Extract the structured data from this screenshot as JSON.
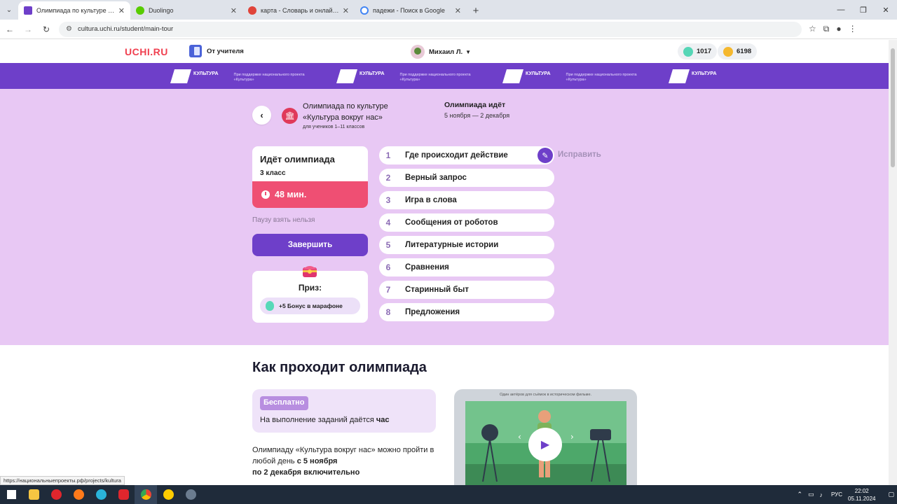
{
  "browser": {
    "tabs": [
      {
        "title": "Олимпиада по культуре «Культ",
        "color": "#6e3fc9",
        "active": true
      },
      {
        "title": "Duolingo",
        "color": "#58cc02",
        "active": false
      },
      {
        "title": "карта - Словарь и онлайн-пер",
        "color": "#e0443a",
        "active": false
      },
      {
        "title": "падежи - Поиск в Google",
        "color": "#4285f4",
        "active": false
      }
    ],
    "url": "cultura.uchi.ru/student/main-tour",
    "status_url": "https://национальныепроекты.рф/projects/kultura"
  },
  "header": {
    "logo": "UCHI.RU",
    "teacher_label": "От учителя",
    "user_name": "Михаил Л.",
    "gems": "1017",
    "coins": "6198"
  },
  "banner": {
    "brand": "КУЛЬТУРА",
    "support_text": "При поддержке национального проекта «Культура»"
  },
  "olympiad": {
    "title_line1": "Олимпиада по культуре",
    "title_line2": "«Культура вокруг нас»",
    "subtitle": "для учеников 1–11 классов",
    "status": "Олимпиада идёт",
    "dates": "5 ноября — 2 декабря",
    "card_heading": "Идёт олимпиада",
    "grade": "3 класс",
    "timer": "48 мин.",
    "no_pause": "Паузу взять нельзя",
    "finish_label": "Завершить",
    "prize_label": "Приз:",
    "prize_bonus": "+5 Бонус в марафоне",
    "fix_label": "Исправить"
  },
  "tasks": [
    {
      "num": "1",
      "name": "Где происходит действие"
    },
    {
      "num": "2",
      "name": "Верный запрос"
    },
    {
      "num": "3",
      "name": "Игра в слова"
    },
    {
      "num": "4",
      "name": "Сообщения от роботов"
    },
    {
      "num": "5",
      "name": "Литературные истории"
    },
    {
      "num": "6",
      "name": "Сравнения"
    },
    {
      "num": "7",
      "name": "Старинный быт"
    },
    {
      "num": "8",
      "name": "Предложения"
    }
  ],
  "howto": {
    "heading": "Как проходит олимпиада",
    "free_tag": "Бесплатно",
    "time_text": "На выполнение заданий даётся",
    "time_bold": "час",
    "anyday_text": "Олимпиаду «Культура вокруг нас» можно пройти в любой день",
    "anyday_bold1": "с 5 ноября",
    "anyday_bold2": "по 2 декабря включительно",
    "video_caption": "Один актёров для съёмок в историческом фильме."
  },
  "taskbar": {
    "lang": "РУС",
    "time": "22:02",
    "date": "05.11.2024"
  },
  "colors": {
    "brand_purple": "#6e3fc9",
    "lilac_bg": "#e8c8f4",
    "timer_red": "#ef4f73",
    "logo_red": "#f04050"
  }
}
